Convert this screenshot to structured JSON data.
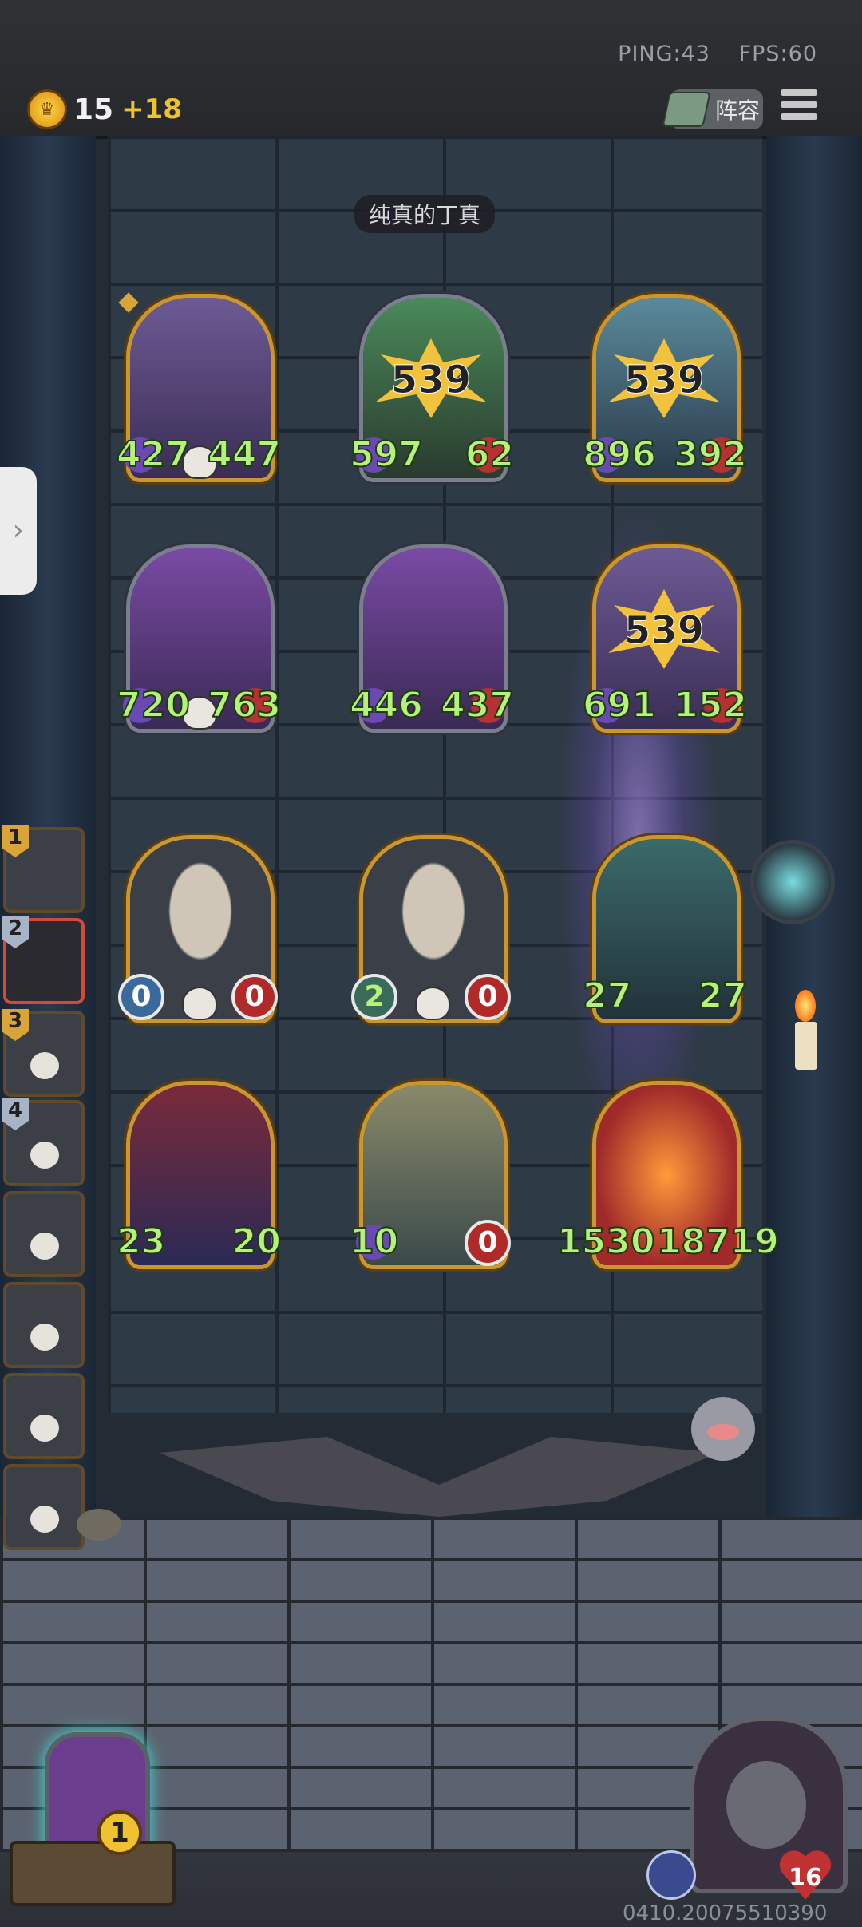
{
  "status": {
    "ping": "PING:43",
    "fps": "FPS:60"
  },
  "economy": {
    "gold": "15",
    "income": "+18"
  },
  "toolbar": {
    "lineup_label": "阵容"
  },
  "opponent": {
    "name": "纯真的丁真"
  },
  "board": {
    "row1": [
      {
        "atk": "427",
        "hp": "447"
      },
      {
        "atk": "597",
        "hp": "62",
        "star": "539"
      },
      {
        "atk": "896",
        "hp": "392",
        "star": "539"
      }
    ],
    "row2": [
      {
        "atk": "720",
        "hp": "763"
      },
      {
        "atk": "446",
        "hp": "437"
      },
      {
        "atk": "691",
        "hp": "152",
        "star": "539"
      }
    ],
    "row3": [
      {
        "atk": "0",
        "hp": "0"
      },
      {
        "atk": "2",
        "hp": "0"
      },
      {
        "atk": "27",
        "hp": "27"
      }
    ],
    "row4": [
      {
        "atk": "23",
        "hp": "20"
      },
      {
        "atk": "10",
        "hp": "0"
      },
      {
        "atk": "1530",
        "hp": "18719"
      }
    ]
  },
  "queue": [
    "1",
    "2",
    "3",
    "4"
  ],
  "shop": {
    "cost": "1"
  },
  "hero": {
    "health": "16"
  },
  "version": "0410.20075510390",
  "colors": {
    "gold_frame": "#c9962f",
    "atk_text": "#b6f27a",
    "active_queue": "#d14a3a"
  }
}
